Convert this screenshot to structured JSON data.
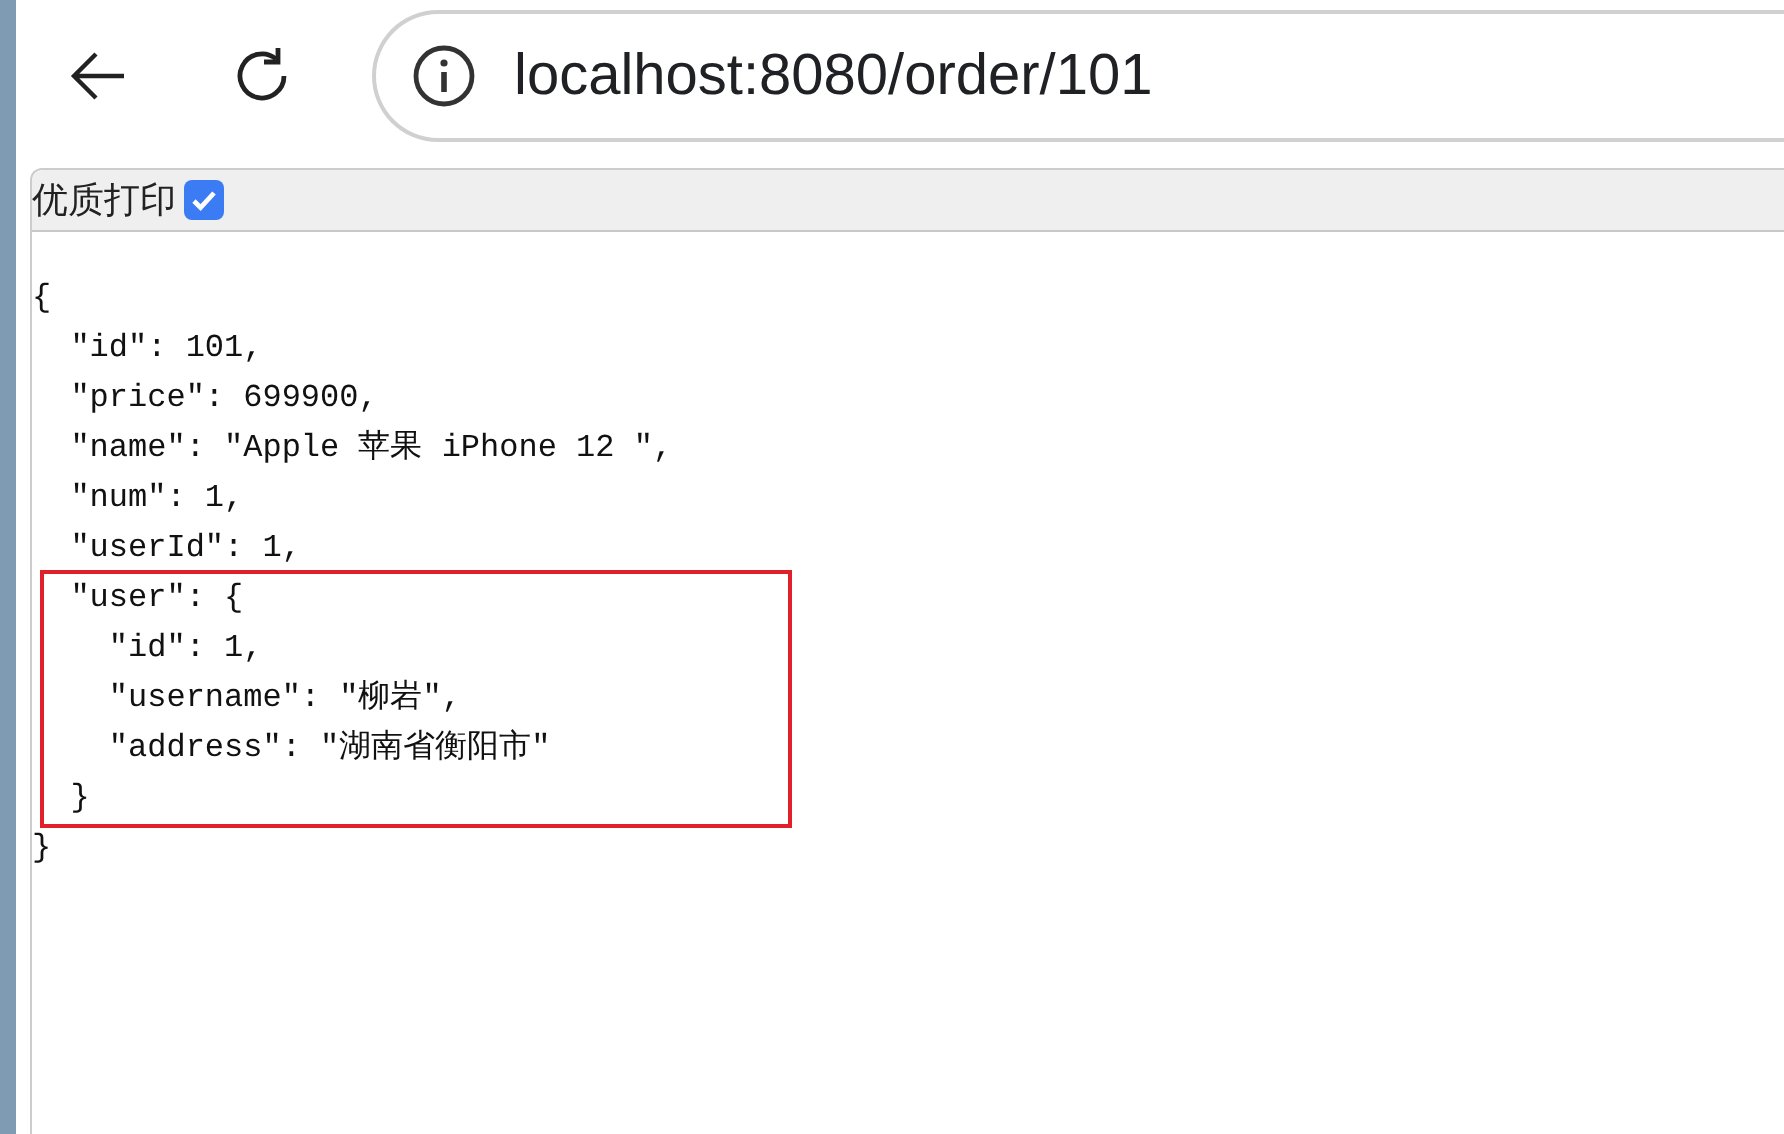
{
  "address_bar": {
    "url": "localhost:8080/order/101"
  },
  "toolbar": {
    "label": "优质打印",
    "checked": true
  },
  "code_lines": [
    {
      "text": "{",
      "highlighted": false
    },
    {
      "text": "  \"id\": 101,",
      "highlighted": false
    },
    {
      "text": "  \"price\": 699900,",
      "highlighted": false
    },
    {
      "text": "  \"name\": \"Apple 苹果 iPhone 12 \",",
      "highlighted": false
    },
    {
      "text": "  \"num\": 1,",
      "highlighted": false
    },
    {
      "text": "  \"userId\": 1,",
      "highlighted": false
    },
    {
      "text": "  \"user\": {",
      "highlighted": true
    },
    {
      "text": "    \"id\": 1,",
      "highlighted": true
    },
    {
      "text": "    \"username\": \"柳岩\",",
      "highlighted": true
    },
    {
      "text": "    \"address\": \"湖南省衡阳市\"",
      "highlighted": true
    },
    {
      "text": "  }",
      "highlighted": true
    },
    {
      "text": "}",
      "highlighted": false
    }
  ]
}
